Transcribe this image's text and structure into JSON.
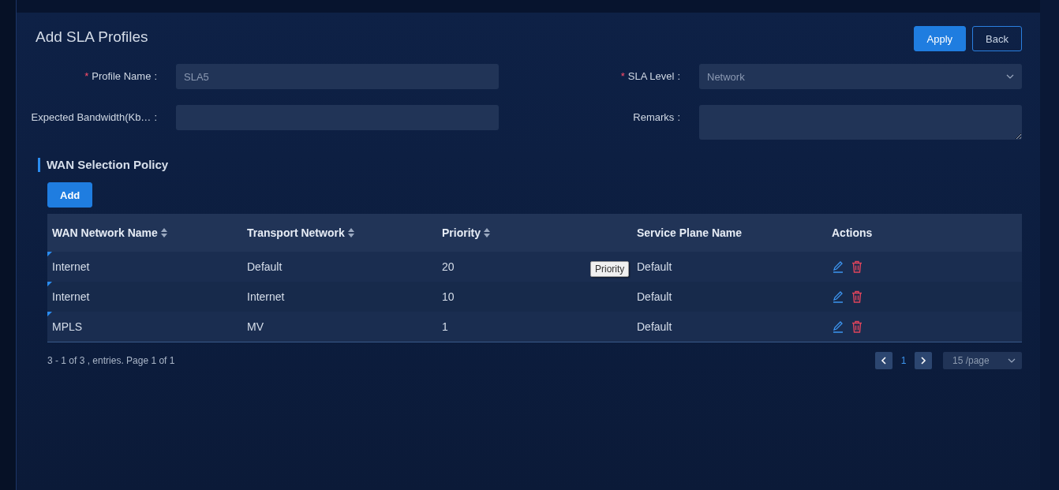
{
  "page": {
    "title": "Add SLA Profiles",
    "buttons": [
      {
        "label": "Apply",
        "kind": "primary"
      },
      {
        "label": "Back",
        "kind": "outline"
      }
    ]
  },
  "form": {
    "fields": [
      {
        "label": "Profile Name",
        "required_mark": "*",
        "separator": ":",
        "kind": "input",
        "value": "SLA5"
      },
      {
        "label": "SLA Level",
        "required_mark": "*",
        "separator": ":",
        "kind": "select",
        "value": "Network"
      },
      {
        "label": "Expected Bandwidth(Kb…",
        "separator": ":",
        "kind": "input"
      },
      {
        "label": "Remarks",
        "separator": ":",
        "kind": "textarea"
      }
    ]
  },
  "section": {
    "title": "WAN Selection Policy",
    "add_button": "Add"
  },
  "table": {
    "columns": [
      {
        "label": "WAN Network Name",
        "sortable": true
      },
      {
        "label": "Transport Network",
        "sortable": true
      },
      {
        "label": "Priority",
        "sortable": true
      },
      {
        "label": "Service Plane Name",
        "sortable": false
      },
      {
        "label": "Actions",
        "sortable": false
      }
    ],
    "rows": [
      {
        "cells": [
          "Internet",
          "Default",
          "20",
          "Default"
        ]
      },
      {
        "cells": [
          "Internet",
          "Internet",
          "10",
          "Default"
        ]
      },
      {
        "cells": [
          "MPLS",
          "MV",
          "1",
          "Default"
        ]
      }
    ],
    "tooltip": "Priority"
  },
  "pagination": {
    "summary": "3 - 1 of 3 , entries. Page 1 of 1",
    "pages": [
      {
        "label": "1",
        "selected": true
      }
    ],
    "page_size": "15 /page"
  }
}
